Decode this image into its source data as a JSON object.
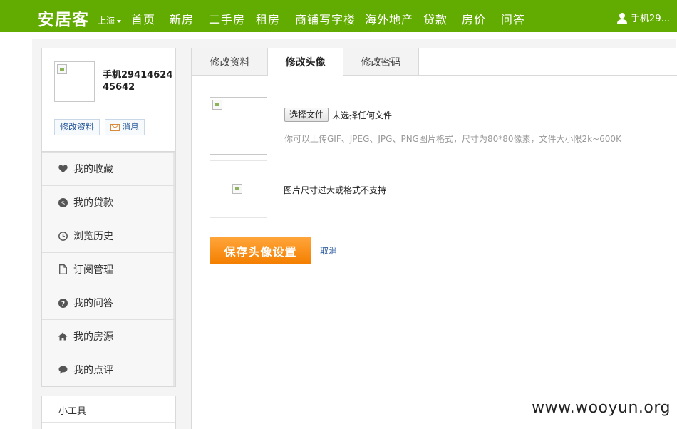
{
  "header": {
    "logo": "安居客",
    "city": "上海",
    "nav": [
      "首页",
      "新房",
      "二手房",
      "租房",
      "商铺写字楼",
      "海外地产",
      "贷款",
      "房价",
      "问答"
    ],
    "user": "手机29..."
  },
  "profile": {
    "username": "手机2941462445642",
    "edit_button": "修改资料",
    "message_button": "消息"
  },
  "sidebar": {
    "items": [
      {
        "label": "我的收藏",
        "icon": "heart-icon"
      },
      {
        "label": "我的贷款",
        "icon": "dollar-icon"
      },
      {
        "label": "浏览历史",
        "icon": "clock-icon"
      },
      {
        "label": "订阅管理",
        "icon": "document-icon"
      },
      {
        "label": "我的问答",
        "icon": "question-icon"
      },
      {
        "label": "我的房源",
        "icon": "home-icon"
      },
      {
        "label": "我的点评",
        "icon": "comment-icon"
      }
    ],
    "tools_title": "小工具"
  },
  "tabs": [
    "修改资料",
    "修改头像",
    "修改密码"
  ],
  "active_tab": "修改头像",
  "avatar_form": {
    "choose_file": "选择文件",
    "file_status": "未选择任何文件",
    "hint": "你可以上传GIF、JPEG、JPG、PNG图片格式，尺寸为80*80像素，文件大小限2k~600K",
    "error": "图片尺寸过大或格式不支持",
    "save": "保存头像设置",
    "cancel": "取消"
  },
  "watermark": "www.wooyun.org",
  "colors": {
    "nav_green": "#62ab00",
    "save_orange": "#f48a0c",
    "link_blue": "#2a5a9c"
  }
}
